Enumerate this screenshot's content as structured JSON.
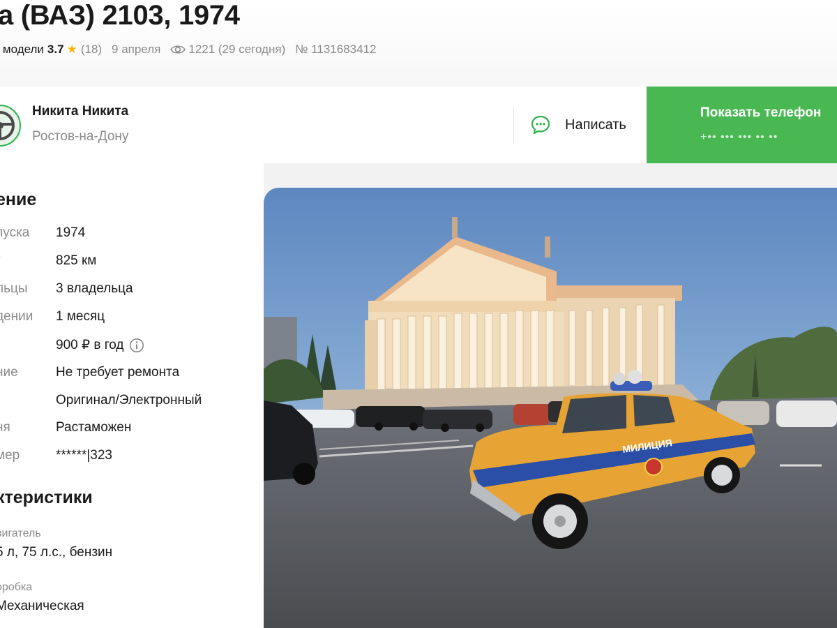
{
  "listing": {
    "title": "а (ВАЗ) 2103, 1974",
    "rating_label": "г модели",
    "rating_value": "3.7",
    "rating_count": "(18)",
    "date": "9 апреля",
    "views": "1221 (29 сегодня)",
    "number": "№ 1131683412"
  },
  "seller": {
    "name": "Никита Никита",
    "city": "Ростов-на-Дону",
    "write_label": "Написать",
    "phone_label": "Показать телефон",
    "phone_mask": "+•• ••• ••• •• ••"
  },
  "details": {
    "section_title": "ение",
    "rows": [
      {
        "label": "пуска",
        "value": "1974"
      },
      {
        "label": "г",
        "value": "825 км"
      },
      {
        "label": "льцы",
        "value": "3 владельца"
      },
      {
        "label": "дении",
        "value": "1 месяц"
      },
      {
        "label": "",
        "value": "900 ₽ в год"
      },
      {
        "label": "ние",
        "value": "Не требует ремонта"
      },
      {
        "label": "",
        "value": "Оригинал/Электронный"
      },
      {
        "label": "ня",
        "value": "Растаможен"
      },
      {
        "label": "мер",
        "value": "******|323"
      }
    ]
  },
  "characteristics": {
    "section_title": "ктеристики",
    "items": [
      {
        "label": "вигатель",
        "value": "5 л, 75 л.с., бензин"
      },
      {
        "label": "оробка",
        "value": "Механическая"
      }
    ]
  },
  "photo": {
    "car_text": "МИЛИЦИЯ"
  },
  "colors": {
    "accent_green": "#49b853",
    "star": "#f5b50a",
    "muted_text": "#8a8a8a"
  }
}
